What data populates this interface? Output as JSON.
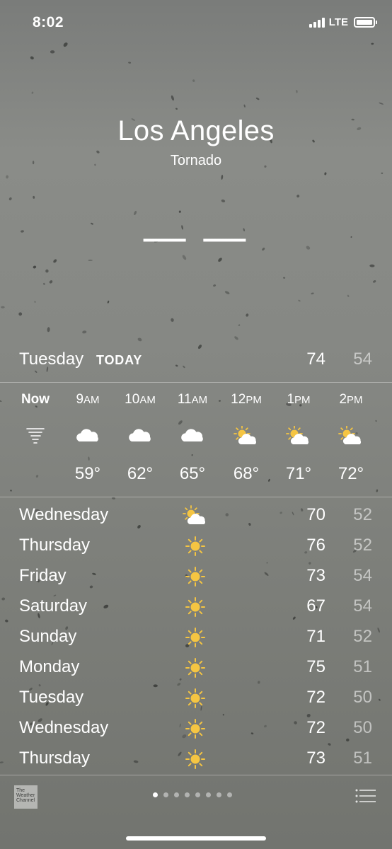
{
  "status_bar": {
    "time": "8:02",
    "network": "LTE"
  },
  "location": {
    "city": "Los Angeles",
    "condition": "Tornado",
    "temperature": "— —"
  },
  "today": {
    "day": "Tuesday",
    "label": "TODAY",
    "high": "74",
    "low": "54"
  },
  "hourly": [
    {
      "hour": "Now",
      "ampm": "",
      "icon": "tornado-icon",
      "temp": ""
    },
    {
      "hour": "9",
      "ampm": "AM",
      "icon": "cloud-icon",
      "temp": "59°"
    },
    {
      "hour": "10",
      "ampm": "AM",
      "icon": "cloud-icon",
      "temp": "62°"
    },
    {
      "hour": "11",
      "ampm": "AM",
      "icon": "cloud-icon",
      "temp": "65°"
    },
    {
      "hour": "12",
      "ampm": "PM",
      "icon": "partly-sunny-icon",
      "temp": "68°"
    },
    {
      "hour": "1",
      "ampm": "PM",
      "icon": "partly-sunny-icon",
      "temp": "71°"
    },
    {
      "hour": "2",
      "ampm": "PM",
      "icon": "partly-sunny-icon",
      "temp": "72°"
    }
  ],
  "daily": [
    {
      "day": "Wednesday",
      "icon": "partly-sunny-icon",
      "high": "70",
      "low": "52"
    },
    {
      "day": "Thursday",
      "icon": "sun-icon",
      "high": "76",
      "low": "52"
    },
    {
      "day": "Friday",
      "icon": "sun-icon",
      "high": "73",
      "low": "54"
    },
    {
      "day": "Saturday",
      "icon": "sun-icon",
      "high": "67",
      "low": "54"
    },
    {
      "day": "Sunday",
      "icon": "sun-icon",
      "high": "71",
      "low": "52"
    },
    {
      "day": "Monday",
      "icon": "sun-icon",
      "high": "75",
      "low": "51"
    },
    {
      "day": "Tuesday",
      "icon": "sun-icon",
      "high": "72",
      "low": "50"
    },
    {
      "day": "Wednesday",
      "icon": "sun-icon",
      "high": "72",
      "low": "50"
    },
    {
      "day": "Thursday",
      "icon": "sun-icon",
      "high": "73",
      "low": "51"
    }
  ],
  "footer": {
    "logo_lines": [
      "The",
      "Weather",
      "Channel"
    ],
    "page_count": 8,
    "active_page": 0
  },
  "colors": {
    "sun": "#f5c542",
    "cloud": "#ffffff"
  }
}
